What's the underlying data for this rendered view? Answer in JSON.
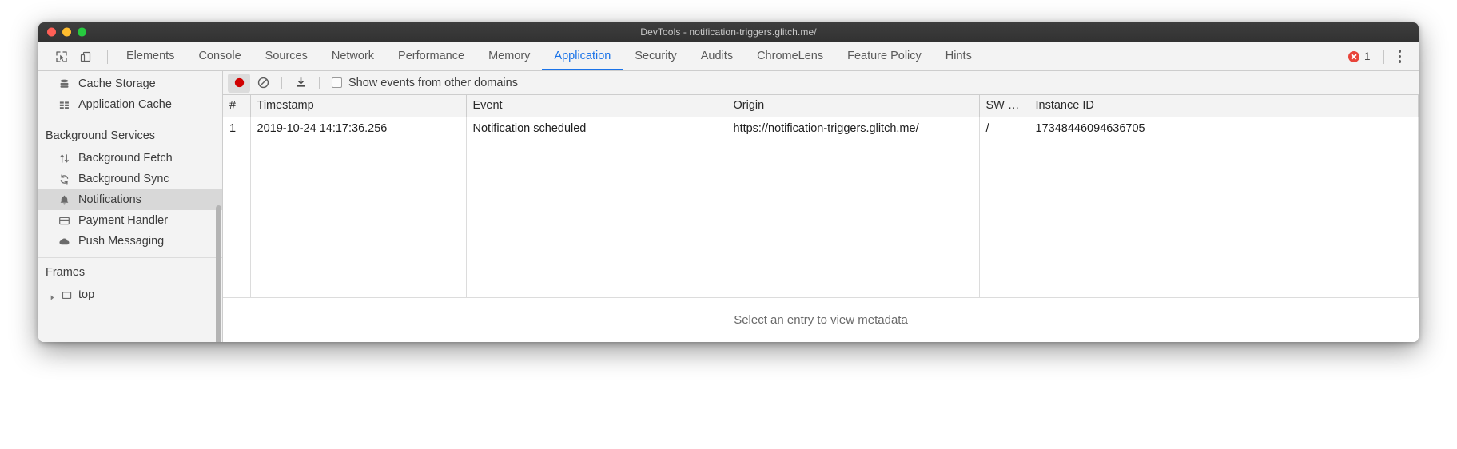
{
  "window": {
    "title": "DevTools - notification-triggers.glitch.me/",
    "traffic_lights": [
      "close",
      "minimize",
      "zoom"
    ],
    "colors": {
      "close": "#ff5f56",
      "minimize": "#ffbd2e",
      "zoom": "#27c93f",
      "accent": "#1a73e8",
      "error": "#e8443a",
      "record": "#d00000"
    }
  },
  "tabstrip": {
    "left_icons": [
      {
        "name": "inspect-element-icon"
      },
      {
        "name": "device-toolbar-icon"
      }
    ],
    "tabs": [
      {
        "label": "Elements",
        "active": false
      },
      {
        "label": "Console",
        "active": false
      },
      {
        "label": "Sources",
        "active": false
      },
      {
        "label": "Network",
        "active": false
      },
      {
        "label": "Performance",
        "active": false
      },
      {
        "label": "Memory",
        "active": false
      },
      {
        "label": "Application",
        "active": true
      },
      {
        "label": "Security",
        "active": false
      },
      {
        "label": "Audits",
        "active": false
      },
      {
        "label": "ChromeLens",
        "active": false
      },
      {
        "label": "Feature Policy",
        "active": false
      },
      {
        "label": "Hints",
        "active": false
      }
    ],
    "error_count": "1",
    "menu_icon": "more-vertical-icon"
  },
  "sidebar": {
    "storage_items": [
      {
        "label": "Cache Storage",
        "icon": "database-icon",
        "selected": false
      },
      {
        "label": "Application Cache",
        "icon": "grid-icon",
        "selected": false
      }
    ],
    "background_services": {
      "title": "Background Services",
      "items": [
        {
          "label": "Background Fetch",
          "icon": "arrows-up-down-icon",
          "selected": false
        },
        {
          "label": "Background Sync",
          "icon": "sync-icon",
          "selected": false
        },
        {
          "label": "Notifications",
          "icon": "bell-icon",
          "selected": true
        },
        {
          "label": "Payment Handler",
          "icon": "credit-card-icon",
          "selected": false
        },
        {
          "label": "Push Messaging",
          "icon": "cloud-icon",
          "selected": false
        }
      ]
    },
    "frames": {
      "title": "Frames",
      "items": [
        {
          "label": "top",
          "icon": "frame-icon",
          "arrow": "chevron-right-icon",
          "expanded": false
        }
      ]
    }
  },
  "panel_toolbar": {
    "record_button": {
      "name": "record-button",
      "icon": "record-circle-icon",
      "active": true
    },
    "clear_button": {
      "name": "clear-button",
      "icon": "no-entry-icon"
    },
    "export_button": {
      "name": "export-button",
      "icon": "download-icon"
    },
    "checkbox": {
      "label": "Show events from other domains",
      "checked": false
    }
  },
  "table": {
    "columns": [
      "#",
      "Timestamp",
      "Event",
      "Origin",
      "SW …",
      "Instance ID"
    ],
    "rows": [
      {
        "num": "1",
        "timestamp": "2019-10-24 14:17:36.256",
        "event": "Notification scheduled",
        "origin": "https://notification-triggers.glitch.me/",
        "sw": "/",
        "instance_id": "17348446094636705"
      }
    ]
  },
  "footer": {
    "empty_message": "Select an entry to view metadata"
  }
}
